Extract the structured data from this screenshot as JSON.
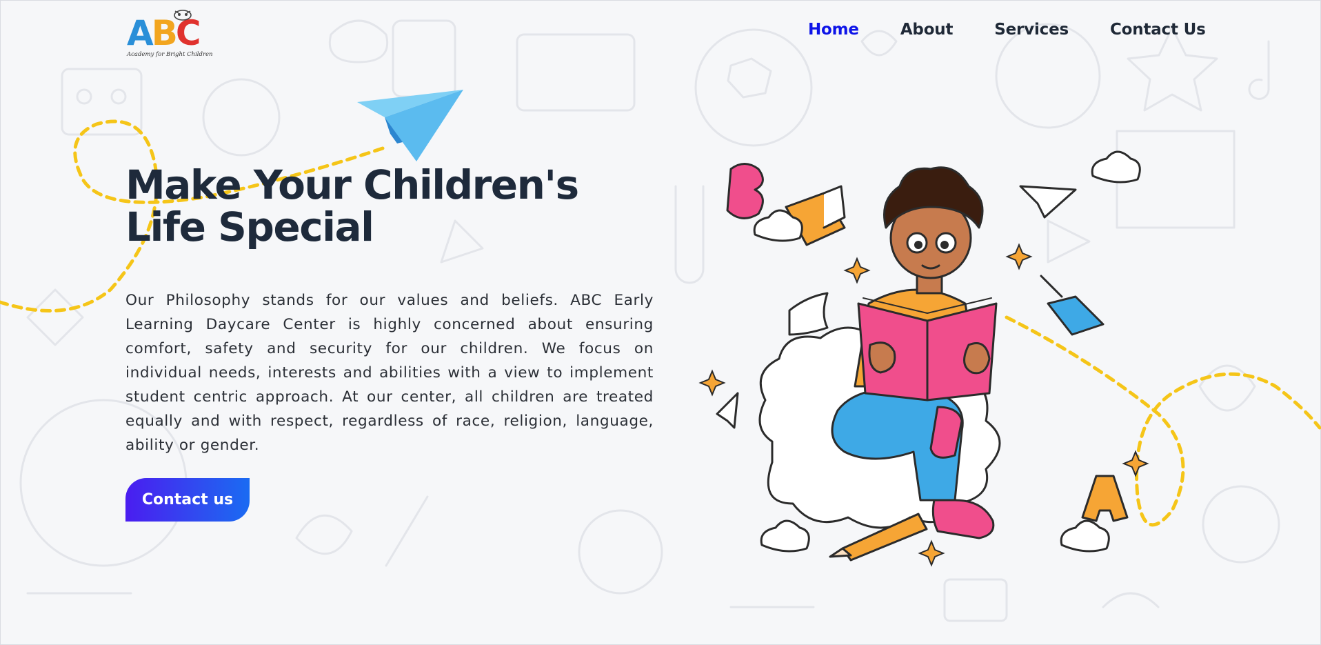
{
  "logo": {
    "letter_a": "A",
    "letter_b": "B",
    "letter_c": "C",
    "tagline": "Academy for Bright Children"
  },
  "nav": {
    "items": [
      {
        "label": "Home",
        "active": true
      },
      {
        "label": "About",
        "active": false
      },
      {
        "label": "Services",
        "active": false
      },
      {
        "label": "Contact Us",
        "active": false
      }
    ]
  },
  "hero": {
    "title": "Make Your Children's Life Special",
    "body": "Our Philosophy stands for our values and beliefs. ABC Early Learning Daycare Center is highly concerned about ensuring comfort, safety and security for our children. We focus on individual needs, interests and abilities with a view to implement student centric approach. At our center, all children are treated equally and with respect, regardless of race, religion, language, ability or gender.",
    "cta_label": "Contact us"
  },
  "colors": {
    "background": "#f6f7f9",
    "nav_active": "#0d14e8",
    "heading": "#1e2a3b",
    "cta_start": "#4a1df0",
    "cta_end": "#1a6bf2",
    "dash_yellow": "#f5c518"
  }
}
